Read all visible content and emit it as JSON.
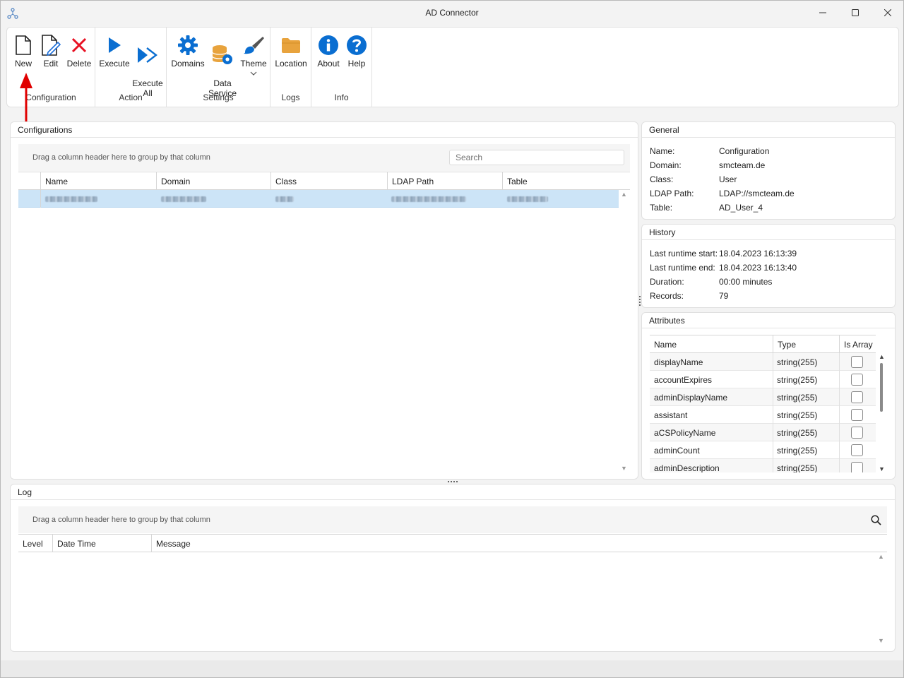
{
  "window": {
    "title": "AD Connector"
  },
  "ribbon": {
    "groups": [
      {
        "label": "Configuration",
        "buttons": [
          {
            "label": "New",
            "icon": "new-document-icon"
          },
          {
            "label": "Edit",
            "icon": "edit-document-icon"
          },
          {
            "label": "Delete",
            "icon": "delete-x-icon"
          }
        ]
      },
      {
        "label": "Action",
        "buttons": [
          {
            "label": "Execute",
            "icon": "play-icon"
          },
          {
            "label": "Execute\nAll",
            "icon": "fast-forward-icon"
          }
        ]
      },
      {
        "label": "Settings",
        "buttons": [
          {
            "label": "Domains",
            "icon": "gear-icon"
          },
          {
            "label": "Data\nService",
            "icon": "database-gear-icon"
          },
          {
            "label": "Theme",
            "icon": "brush-icon"
          }
        ]
      },
      {
        "label": "Logs",
        "buttons": [
          {
            "label": "Location",
            "icon": "folder-icon"
          }
        ]
      },
      {
        "label": "Info",
        "buttons": [
          {
            "label": "About",
            "icon": "info-icon"
          },
          {
            "label": "Help",
            "icon": "help-icon"
          }
        ]
      }
    ]
  },
  "configurations": {
    "title": "Configurations",
    "group_hint": "Drag a column header here to group by that column",
    "search_placeholder": "Search",
    "columns": [
      "Name",
      "Domain",
      "Class",
      "LDAP Path",
      "Table"
    ]
  },
  "general": {
    "title": "General",
    "rows": [
      {
        "key": "Name:",
        "value": "Configuration"
      },
      {
        "key": "Domain:",
        "value": "smcteam.de"
      },
      {
        "key": "Class:",
        "value": "User"
      },
      {
        "key": "LDAP Path:",
        "value": "LDAP://smcteam.de"
      },
      {
        "key": "Table:",
        "value": "AD_User_4"
      }
    ]
  },
  "history": {
    "title": "History",
    "rows": [
      {
        "key": "Last runtime start:",
        "value": "18.04.2023 16:13:39"
      },
      {
        "key": "Last runtime end:",
        "value": "18.04.2023 16:13:40"
      },
      {
        "key": "Duration:",
        "value": "00:00 minutes"
      },
      {
        "key": "Records:",
        "value": "79"
      }
    ]
  },
  "attributes": {
    "title": "Attributes",
    "columns": [
      "Name",
      "Type",
      "Is Array"
    ],
    "rows": [
      {
        "name": "displayName",
        "type": "string(255)"
      },
      {
        "name": "accountExpires",
        "type": "string(255)"
      },
      {
        "name": "adminDisplayName",
        "type": "string(255)"
      },
      {
        "name": "assistant",
        "type": "string(255)"
      },
      {
        "name": "aCSPolicyName",
        "type": "string(255)"
      },
      {
        "name": "adminCount",
        "type": "string(255)"
      },
      {
        "name": "adminDescription",
        "type": "string(255)"
      }
    ]
  },
  "log": {
    "title": "Log",
    "group_hint": "Drag a column header here to group by that column",
    "columns": [
      "Level",
      "Date Time",
      "Message"
    ]
  },
  "colors": {
    "accent": "#0067c0",
    "delete": "#e81123",
    "folder": "#e8a33d",
    "arrow": "#e00000",
    "selection": "#cce4f7"
  }
}
